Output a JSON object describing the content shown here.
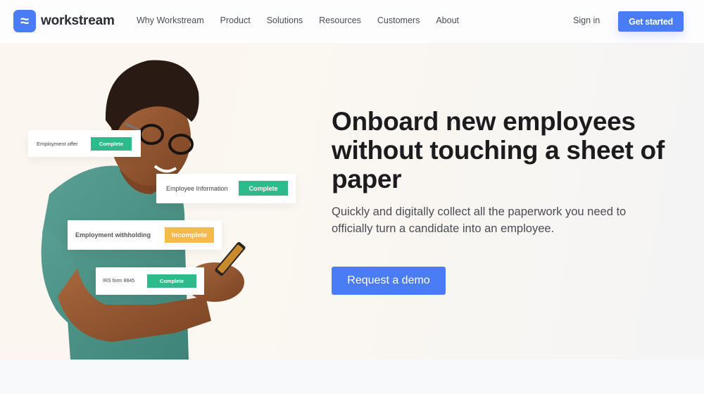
{
  "brand": {
    "name": "workstream",
    "logo_icon": "approx-waves-icon",
    "accent": "#4a7cf6"
  },
  "nav": {
    "links": [
      "Why Workstream",
      "Product",
      "Solutions",
      "Resources",
      "Customers",
      "About"
    ],
    "sign_in": "Sign in",
    "get_started": "Get started"
  },
  "hero": {
    "headline": "Onboard new employees without touching a sheet of paper",
    "subheadline": "Quickly and digitally collect all the paperwork you need to officially turn a candidate into an employee.",
    "cta": "Request a demo",
    "cards": [
      {
        "label": "Employment offer",
        "status": "Complete",
        "status_color": "#2dbb8b"
      },
      {
        "label": "Employee Information",
        "status": "Complete",
        "status_color": "#2dbb8b"
      },
      {
        "label": "Employment withholding",
        "status": "Incomplete",
        "status_color": "#f6b94a"
      },
      {
        "label": "IRS form 8845",
        "status": "Complete",
        "status_color": "#2dbb8b"
      }
    ]
  }
}
